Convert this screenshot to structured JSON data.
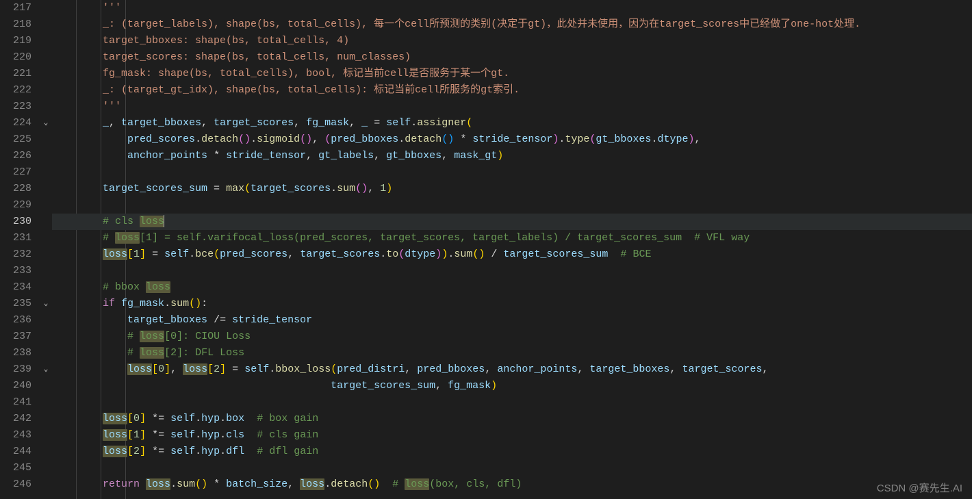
{
  "watermark": "CSDN @赛先生.AI",
  "highlight_word": "loss",
  "active_line": 230,
  "fold_markers": {
    "224": "v",
    "235": "v",
    "239": "v"
  },
  "lines": [
    {
      "n": 217,
      "ind": 2,
      "tokens": [
        {
          "t": "'''",
          "c": "tk-str"
        }
      ]
    },
    {
      "n": 218,
      "ind": 2,
      "tokens": [
        {
          "t": "_: (target_labels), shape(bs, total_cells), 每一个cell所预测的类别(决定于gt)，此处并未使用，因为在target_scores中已经做了one-hot处理.",
          "c": "tk-str"
        }
      ]
    },
    {
      "n": 219,
      "ind": 2,
      "tokens": [
        {
          "t": "target_bboxes: shape(bs, total_cells, 4)",
          "c": "tk-str"
        }
      ]
    },
    {
      "n": 220,
      "ind": 2,
      "tokens": [
        {
          "t": "target_scores: shape(bs, total_cells, num_classes)",
          "c": "tk-str"
        }
      ]
    },
    {
      "n": 221,
      "ind": 2,
      "tokens": [
        {
          "t": "fg_mask: shape(bs, total_cells), bool, 标记当前cell是否服务于某一个gt.",
          "c": "tk-str"
        }
      ]
    },
    {
      "n": 222,
      "ind": 2,
      "tokens": [
        {
          "t": "_: (target_gt_idx), shape(bs, total_cells): 标记当前cell所服务的gt索引.",
          "c": "tk-str"
        }
      ]
    },
    {
      "n": 223,
      "ind": 2,
      "tokens": [
        {
          "t": "'''",
          "c": "tk-str"
        }
      ]
    },
    {
      "n": 224,
      "ind": 2,
      "tokens": [
        {
          "t": "_",
          "c": "tk-var"
        },
        {
          "t": ", ",
          "c": "tk-punc"
        },
        {
          "t": "target_bboxes",
          "c": "tk-var"
        },
        {
          "t": ", ",
          "c": "tk-punc"
        },
        {
          "t": "target_scores",
          "c": "tk-var"
        },
        {
          "t": ", ",
          "c": "tk-punc"
        },
        {
          "t": "fg_mask",
          "c": "tk-var"
        },
        {
          "t": ", ",
          "c": "tk-punc"
        },
        {
          "t": "_",
          "c": "tk-var"
        },
        {
          "t": " = ",
          "c": "tk-op"
        },
        {
          "t": "self",
          "c": "tk-self"
        },
        {
          "t": ".",
          "c": "tk-punc"
        },
        {
          "t": "assigner",
          "c": "tk-fn"
        },
        {
          "t": "(",
          "c": "tk-punc-y"
        }
      ]
    },
    {
      "n": 225,
      "ind": 3,
      "tokens": [
        {
          "t": "pred_scores",
          "c": "tk-var"
        },
        {
          "t": ".",
          "c": "tk-punc"
        },
        {
          "t": "detach",
          "c": "tk-fn"
        },
        {
          "t": "(",
          "c": "tk-punc-p"
        },
        {
          "t": ")",
          "c": "tk-punc-p"
        },
        {
          "t": ".",
          "c": "tk-punc"
        },
        {
          "t": "sigmoid",
          "c": "tk-fn"
        },
        {
          "t": "(",
          "c": "tk-punc-p"
        },
        {
          "t": ")",
          "c": "tk-punc-p"
        },
        {
          "t": ", ",
          "c": "tk-punc"
        },
        {
          "t": "(",
          "c": "tk-punc-p"
        },
        {
          "t": "pred_bboxes",
          "c": "tk-var"
        },
        {
          "t": ".",
          "c": "tk-punc"
        },
        {
          "t": "detach",
          "c": "tk-fn"
        },
        {
          "t": "(",
          "c": "tk-punc-b"
        },
        {
          "t": ")",
          "c": "tk-punc-b"
        },
        {
          "t": " * ",
          "c": "tk-op"
        },
        {
          "t": "stride_tensor",
          "c": "tk-var"
        },
        {
          "t": ")",
          "c": "tk-punc-p"
        },
        {
          "t": ".",
          "c": "tk-punc"
        },
        {
          "t": "type",
          "c": "tk-fn"
        },
        {
          "t": "(",
          "c": "tk-punc-p"
        },
        {
          "t": "gt_bboxes",
          "c": "tk-var"
        },
        {
          "t": ".",
          "c": "tk-punc"
        },
        {
          "t": "dtype",
          "c": "tk-var"
        },
        {
          "t": ")",
          "c": "tk-punc-p"
        },
        {
          "t": ",",
          "c": "tk-punc"
        }
      ]
    },
    {
      "n": 226,
      "ind": 3,
      "tokens": [
        {
          "t": "anchor_points",
          "c": "tk-var"
        },
        {
          "t": " * ",
          "c": "tk-op"
        },
        {
          "t": "stride_tensor",
          "c": "tk-var"
        },
        {
          "t": ", ",
          "c": "tk-punc"
        },
        {
          "t": "gt_labels",
          "c": "tk-var"
        },
        {
          "t": ", ",
          "c": "tk-punc"
        },
        {
          "t": "gt_bboxes",
          "c": "tk-var"
        },
        {
          "t": ", ",
          "c": "tk-punc"
        },
        {
          "t": "mask_gt",
          "c": "tk-var"
        },
        {
          "t": ")",
          "c": "tk-punc-y"
        }
      ]
    },
    {
      "n": 227,
      "ind": 0,
      "tokens": []
    },
    {
      "n": 228,
      "ind": 2,
      "tokens": [
        {
          "t": "target_scores_sum",
          "c": "tk-var"
        },
        {
          "t": " = ",
          "c": "tk-op"
        },
        {
          "t": "max",
          "c": "tk-fn"
        },
        {
          "t": "(",
          "c": "tk-punc-y"
        },
        {
          "t": "target_scores",
          "c": "tk-var"
        },
        {
          "t": ".",
          "c": "tk-punc"
        },
        {
          "t": "sum",
          "c": "tk-fn"
        },
        {
          "t": "(",
          "c": "tk-punc-p"
        },
        {
          "t": ")",
          "c": "tk-punc-p"
        },
        {
          "t": ", ",
          "c": "tk-punc"
        },
        {
          "t": "1",
          "c": "tk-num"
        },
        {
          "t": ")",
          "c": "tk-punc-y"
        }
      ]
    },
    {
      "n": 229,
      "ind": 0,
      "tokens": []
    },
    {
      "n": 230,
      "ind": 2,
      "tokens": [
        {
          "t": "# cls ",
          "c": "tk-cmt"
        },
        {
          "t": "loss",
          "c": "tk-cmt",
          "hl": true
        },
        {
          "cursor": true
        }
      ]
    },
    {
      "n": 231,
      "ind": 2,
      "tokens": [
        {
          "t": "# ",
          "c": "tk-cmt"
        },
        {
          "t": "loss",
          "c": "tk-cmt",
          "hl": true
        },
        {
          "t": "[1] = self.varifocal_loss(pred_scores, target_scores, target_labels) / target_scores_sum  # VFL way",
          "c": "tk-cmt"
        }
      ]
    },
    {
      "n": 232,
      "ind": 2,
      "tokens": [
        {
          "t": "loss",
          "c": "tk-var",
          "hl": true
        },
        {
          "t": "[",
          "c": "tk-punc-y"
        },
        {
          "t": "1",
          "c": "tk-num"
        },
        {
          "t": "]",
          "c": "tk-punc-y"
        },
        {
          "t": " = ",
          "c": "tk-op"
        },
        {
          "t": "self",
          "c": "tk-self"
        },
        {
          "t": ".",
          "c": "tk-punc"
        },
        {
          "t": "bce",
          "c": "tk-fn"
        },
        {
          "t": "(",
          "c": "tk-punc-y"
        },
        {
          "t": "pred_scores",
          "c": "tk-var"
        },
        {
          "t": ", ",
          "c": "tk-punc"
        },
        {
          "t": "target_scores",
          "c": "tk-var"
        },
        {
          "t": ".",
          "c": "tk-punc"
        },
        {
          "t": "to",
          "c": "tk-fn"
        },
        {
          "t": "(",
          "c": "tk-punc-p"
        },
        {
          "t": "dtype",
          "c": "tk-var"
        },
        {
          "t": ")",
          "c": "tk-punc-p"
        },
        {
          "t": ")",
          "c": "tk-punc-y"
        },
        {
          "t": ".",
          "c": "tk-punc"
        },
        {
          "t": "sum",
          "c": "tk-fn"
        },
        {
          "t": "(",
          "c": "tk-punc-y"
        },
        {
          "t": ")",
          "c": "tk-punc-y"
        },
        {
          "t": " / ",
          "c": "tk-op"
        },
        {
          "t": "target_scores_sum",
          "c": "tk-var"
        },
        {
          "t": "  ",
          "c": "tk-op"
        },
        {
          "t": "# BCE",
          "c": "tk-cmt"
        }
      ]
    },
    {
      "n": 233,
      "ind": 0,
      "tokens": []
    },
    {
      "n": 234,
      "ind": 2,
      "tokens": [
        {
          "t": "# bbox ",
          "c": "tk-cmt"
        },
        {
          "t": "loss",
          "c": "tk-cmt",
          "hl": true
        }
      ]
    },
    {
      "n": 235,
      "ind": 2,
      "tokens": [
        {
          "t": "if",
          "c": "tk-kw"
        },
        {
          "t": " ",
          "c": "tk-op"
        },
        {
          "t": "fg_mask",
          "c": "tk-var"
        },
        {
          "t": ".",
          "c": "tk-punc"
        },
        {
          "t": "sum",
          "c": "tk-fn"
        },
        {
          "t": "(",
          "c": "tk-punc-y"
        },
        {
          "t": ")",
          "c": "tk-punc-y"
        },
        {
          "t": ":",
          "c": "tk-punc"
        }
      ]
    },
    {
      "n": 236,
      "ind": 3,
      "tokens": [
        {
          "t": "target_bboxes",
          "c": "tk-var"
        },
        {
          "t": " /= ",
          "c": "tk-op"
        },
        {
          "t": "stride_tensor",
          "c": "tk-var"
        }
      ]
    },
    {
      "n": 237,
      "ind": 3,
      "tokens": [
        {
          "t": "# ",
          "c": "tk-cmt"
        },
        {
          "t": "loss",
          "c": "tk-cmt",
          "hl": true
        },
        {
          "t": "[0]: CIOU Loss",
          "c": "tk-cmt"
        }
      ]
    },
    {
      "n": 238,
      "ind": 3,
      "tokens": [
        {
          "t": "# ",
          "c": "tk-cmt"
        },
        {
          "t": "loss",
          "c": "tk-cmt",
          "hl": true
        },
        {
          "t": "[2]: DFL Loss",
          "c": "tk-cmt"
        }
      ]
    },
    {
      "n": 239,
      "ind": 3,
      "tokens": [
        {
          "t": "loss",
          "c": "tk-var",
          "hl": true
        },
        {
          "t": "[",
          "c": "tk-punc-y"
        },
        {
          "t": "0",
          "c": "tk-num"
        },
        {
          "t": "]",
          "c": "tk-punc-y"
        },
        {
          "t": ", ",
          "c": "tk-punc"
        },
        {
          "t": "loss",
          "c": "tk-var",
          "hl": true
        },
        {
          "t": "[",
          "c": "tk-punc-y"
        },
        {
          "t": "2",
          "c": "tk-num"
        },
        {
          "t": "]",
          "c": "tk-punc-y"
        },
        {
          "t": " = ",
          "c": "tk-op"
        },
        {
          "t": "self",
          "c": "tk-self"
        },
        {
          "t": ".",
          "c": "tk-punc"
        },
        {
          "t": "bbox_loss",
          "c": "tk-fn"
        },
        {
          "t": "(",
          "c": "tk-punc-y"
        },
        {
          "t": "pred_distri",
          "c": "tk-var"
        },
        {
          "t": ", ",
          "c": "tk-punc"
        },
        {
          "t": "pred_bboxes",
          "c": "tk-var"
        },
        {
          "t": ", ",
          "c": "tk-punc"
        },
        {
          "t": "anchor_points",
          "c": "tk-var"
        },
        {
          "t": ", ",
          "c": "tk-punc"
        },
        {
          "t": "target_bboxes",
          "c": "tk-var"
        },
        {
          "t": ", ",
          "c": "tk-punc"
        },
        {
          "t": "target_scores",
          "c": "tk-var"
        },
        {
          "t": ",",
          "c": "tk-punc"
        }
      ]
    },
    {
      "n": 240,
      "ind": 3,
      "extra_pad": "                                 ",
      "tokens": [
        {
          "t": "target_scores_sum",
          "c": "tk-var"
        },
        {
          "t": ", ",
          "c": "tk-punc"
        },
        {
          "t": "fg_mask",
          "c": "tk-var"
        },
        {
          "t": ")",
          "c": "tk-punc-y"
        }
      ]
    },
    {
      "n": 241,
      "ind": 0,
      "tokens": []
    },
    {
      "n": 242,
      "ind": 2,
      "tokens": [
        {
          "t": "loss",
          "c": "tk-var",
          "hl": true
        },
        {
          "t": "[",
          "c": "tk-punc-y"
        },
        {
          "t": "0",
          "c": "tk-num"
        },
        {
          "t": "]",
          "c": "tk-punc-y"
        },
        {
          "t": " *= ",
          "c": "tk-op"
        },
        {
          "t": "self",
          "c": "tk-self"
        },
        {
          "t": ".",
          "c": "tk-punc"
        },
        {
          "t": "hyp",
          "c": "tk-var"
        },
        {
          "t": ".",
          "c": "tk-punc"
        },
        {
          "t": "box",
          "c": "tk-var"
        },
        {
          "t": "  ",
          "c": "tk-op"
        },
        {
          "t": "# box gain",
          "c": "tk-cmt"
        }
      ]
    },
    {
      "n": 243,
      "ind": 2,
      "tokens": [
        {
          "t": "loss",
          "c": "tk-var",
          "hl": true
        },
        {
          "t": "[",
          "c": "tk-punc-y"
        },
        {
          "t": "1",
          "c": "tk-num"
        },
        {
          "t": "]",
          "c": "tk-punc-y"
        },
        {
          "t": " *= ",
          "c": "tk-op"
        },
        {
          "t": "self",
          "c": "tk-self"
        },
        {
          "t": ".",
          "c": "tk-punc"
        },
        {
          "t": "hyp",
          "c": "tk-var"
        },
        {
          "t": ".",
          "c": "tk-punc"
        },
        {
          "t": "cls",
          "c": "tk-var"
        },
        {
          "t": "  ",
          "c": "tk-op"
        },
        {
          "t": "# cls gain",
          "c": "tk-cmt"
        }
      ]
    },
    {
      "n": 244,
      "ind": 2,
      "tokens": [
        {
          "t": "loss",
          "c": "tk-var",
          "hl": true
        },
        {
          "t": "[",
          "c": "tk-punc-y"
        },
        {
          "t": "2",
          "c": "tk-num"
        },
        {
          "t": "]",
          "c": "tk-punc-y"
        },
        {
          "t": " *= ",
          "c": "tk-op"
        },
        {
          "t": "self",
          "c": "tk-self"
        },
        {
          "t": ".",
          "c": "tk-punc"
        },
        {
          "t": "hyp",
          "c": "tk-var"
        },
        {
          "t": ".",
          "c": "tk-punc"
        },
        {
          "t": "dfl",
          "c": "tk-var"
        },
        {
          "t": "  ",
          "c": "tk-op"
        },
        {
          "t": "# dfl gain",
          "c": "tk-cmt"
        }
      ]
    },
    {
      "n": 245,
      "ind": 0,
      "tokens": []
    },
    {
      "n": 246,
      "ind": 2,
      "tokens": [
        {
          "t": "return",
          "c": "tk-kw"
        },
        {
          "t": " ",
          "c": "tk-op"
        },
        {
          "t": "loss",
          "c": "tk-var",
          "hl": true
        },
        {
          "t": ".",
          "c": "tk-punc"
        },
        {
          "t": "sum",
          "c": "tk-fn"
        },
        {
          "t": "(",
          "c": "tk-punc-y"
        },
        {
          "t": ")",
          "c": "tk-punc-y"
        },
        {
          "t": " * ",
          "c": "tk-op"
        },
        {
          "t": "batch_size",
          "c": "tk-var"
        },
        {
          "t": ", ",
          "c": "tk-punc"
        },
        {
          "t": "loss",
          "c": "tk-var",
          "hl": true
        },
        {
          "t": ".",
          "c": "tk-punc"
        },
        {
          "t": "detach",
          "c": "tk-fn"
        },
        {
          "t": "(",
          "c": "tk-punc-y"
        },
        {
          "t": ")",
          "c": "tk-punc-y"
        },
        {
          "t": "  ",
          "c": "tk-op"
        },
        {
          "t": "# ",
          "c": "tk-cmt"
        },
        {
          "t": "loss",
          "c": "tk-cmt",
          "hl": true
        },
        {
          "t": "(box, cls, dfl)",
          "c": "tk-cmt"
        }
      ]
    }
  ]
}
